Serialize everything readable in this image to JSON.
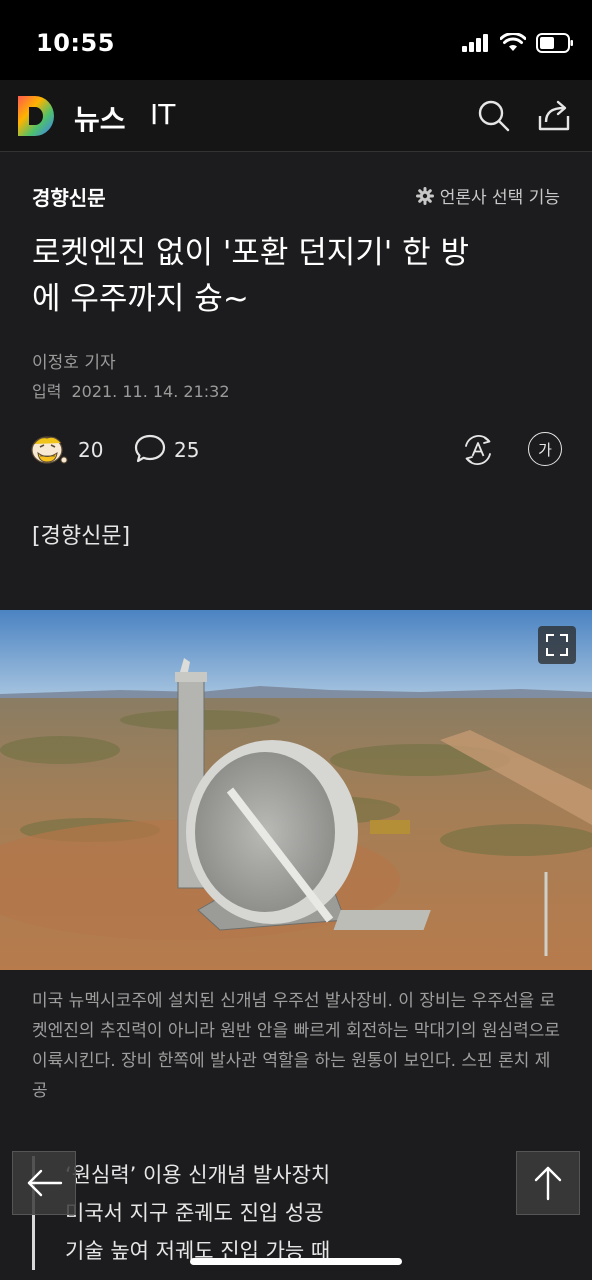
{
  "status_bar": {
    "time": "10:55"
  },
  "nav": {
    "title": "뉴스",
    "section": "IT"
  },
  "article": {
    "press": "경향신문",
    "press_select_label": "언론사 선택 기능",
    "headline_line1": "로켓엔진 없이 '포환 던지기' 한 방",
    "headline_line2": "에 우주까지 슝~",
    "reporter": "이정호 기자",
    "date_label": "입력",
    "date": "2021. 11. 14. 21:32",
    "reaction_count": "20",
    "comment_count": "25",
    "font_button_label": "가",
    "source_tag": "[경향신문]",
    "caption": "미국 뉴멕시코주에 설치된 신개념 우주선 발사장비. 이 장비는 우주선을 로켓엔진의 추진력이 아니라 원반 안을 빠르게 회전하는 막대기의 원심력으로 이륙시킨다. 장비 한쪽에 발사관 역할을 하는 원통이 보인다. 스핀 론치 제공",
    "summary": [
      "‘원심력’ 이용 신개념 발사장치",
      "미국서 지구 준궤도 진입 성공",
      "기술 높여 저궤도 진입 가능 때"
    ]
  },
  "colors": {
    "background": "#1c1c1e",
    "nav_background": "#151515",
    "text": "#f2f2f2",
    "muted": "#9e9e9e"
  },
  "icons": [
    "signal-icon",
    "wifi-icon",
    "battery-icon",
    "daum-logo",
    "search-icon",
    "share-icon",
    "gear-icon",
    "reaction-icon",
    "comment-icon",
    "tts-icon",
    "expand-icon",
    "back-arrow-icon",
    "up-arrow-icon"
  ]
}
